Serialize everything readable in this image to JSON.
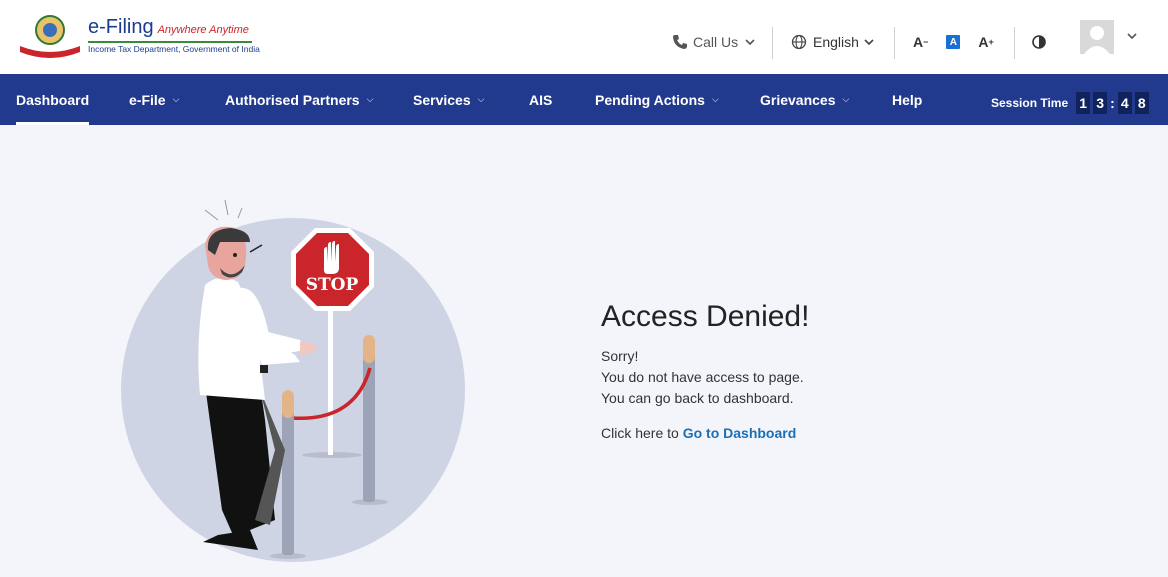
{
  "header": {
    "brand_title": "e-Filing",
    "brand_tagline": "Anywhere Anytime",
    "brand_subtitle": "Income Tax Department, Government of India",
    "call_us": "Call Us",
    "language": "English",
    "font_decrease": "A",
    "font_default": "A",
    "font_increase": "A"
  },
  "nav": {
    "items": [
      {
        "label": "Dashboard",
        "active": true
      },
      {
        "label": "e-File"
      },
      {
        "label": "Authorised Partners"
      },
      {
        "label": "Services"
      },
      {
        "label": "AIS"
      },
      {
        "label": "Pending Actions"
      },
      {
        "label": "Grievances"
      },
      {
        "label": "Help"
      }
    ],
    "session_label": "Session Time",
    "session_digits": [
      "1",
      "3",
      "4",
      "8"
    ],
    "session_colon": ":"
  },
  "illustration": {
    "stop_sign_text": "STOP"
  },
  "main": {
    "title": "Access Denied!",
    "line1": "Sorry!",
    "line2": "You do not have access to page.",
    "line3": "You can go back to dashboard.",
    "cta_prefix": "Click here to",
    "cta_link": "Go to Dashboard"
  },
  "colors": {
    "nav_bg": "#223a8d",
    "link": "#1a6fb5",
    "stop_red": "#c9252b"
  }
}
